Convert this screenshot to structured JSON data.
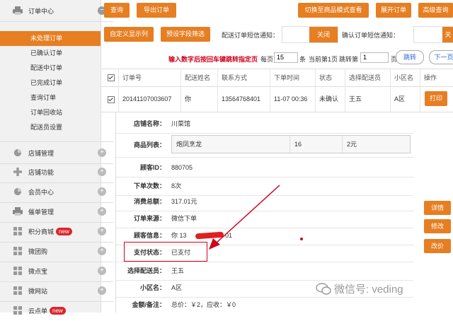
{
  "sidebar": {
    "order_center": "订单中心",
    "order_items": [
      "未处理订单",
      "已确认订单",
      "配送中订单",
      "已完成订单",
      "查询订单",
      "订单回收站",
      "配送员设置"
    ],
    "active_index": 0,
    "sections": [
      {
        "label": "店铺管理"
      },
      {
        "label": "店铺功能"
      },
      {
        "label": "会员中心"
      },
      {
        "label": "催单管理"
      },
      {
        "label": "积分商城",
        "badge": "new"
      },
      {
        "label": "微团购"
      },
      {
        "label": "微点宝"
      },
      {
        "label": "微网站"
      },
      {
        "label": "云点单",
        "badge": "new"
      }
    ]
  },
  "toolbar": {
    "query": "查询",
    "export": "导出订单",
    "switch_mode": "切换至商品模式查看",
    "expand": "展开订单",
    "advanced": "高级查询",
    "custom_display": "自定义显示列",
    "preset_filter": "预设字段筛选",
    "delivery_sms_label": "配送订单短信通知：",
    "delivery_sms_state": "关闭",
    "confirm_sms_label": "确认订单短信通知：",
    "confirm_sms_state": "关闭"
  },
  "pagination": {
    "hint": "输入数字后按回车键跳转指定页",
    "per_page_label": "每页",
    "per_page_value": "15",
    "per_page_unit": "条",
    "current": "当前第1页",
    "jump_label": "跳转第",
    "jump_value": "1",
    "jump_unit": "页",
    "jump_button": "跳转",
    "next_button": "下一页"
  },
  "table": {
    "headers": [
      "订单号",
      "配送姓名",
      "联系方式",
      "下单时间",
      "状态",
      "选择配送员",
      "小区名",
      "操作"
    ],
    "row": {
      "order_no": "20141107003607",
      "name": "你",
      "phone": "13564768401",
      "time": "11-07 00:36",
      "status": "未确认",
      "courier": "王五",
      "community": "A区",
      "action": "打印"
    }
  },
  "detail": {
    "store_label": "店铺名称：",
    "store_value": "川菜馆",
    "products_label": "商品列表：",
    "product": {
      "name": "炮凤烹龙",
      "qty": "16",
      "price": "2元"
    },
    "customer_id_label": "顾客ID：",
    "customer_id_value": "880705",
    "order_count_label": "下单次数：",
    "order_count_value": "8次",
    "spend_label": "消费总额：",
    "spend_value": "317.01元",
    "source_label": "订单来源：",
    "source_value": "微信下单",
    "customer_info_label": "顾客信息：",
    "customer_info_value": "你  13",
    "customer_info_tail": "01",
    "pay_label": "支付状态：",
    "pay_value": "已支付",
    "courier_label": "选择配送员：",
    "courier_value": "王五",
    "community_label": "小区名：",
    "community_value": "A区",
    "amount_label": "金额/备注：",
    "amount_value": "总价：￥2，应收：￥0"
  },
  "side_buttons": [
    "详情",
    "修改",
    "改价"
  ],
  "watermark": "微信号: veding",
  "colors": {
    "accent": "#e67e22",
    "annotation": "#d0021b",
    "badge": "#d9262b"
  }
}
